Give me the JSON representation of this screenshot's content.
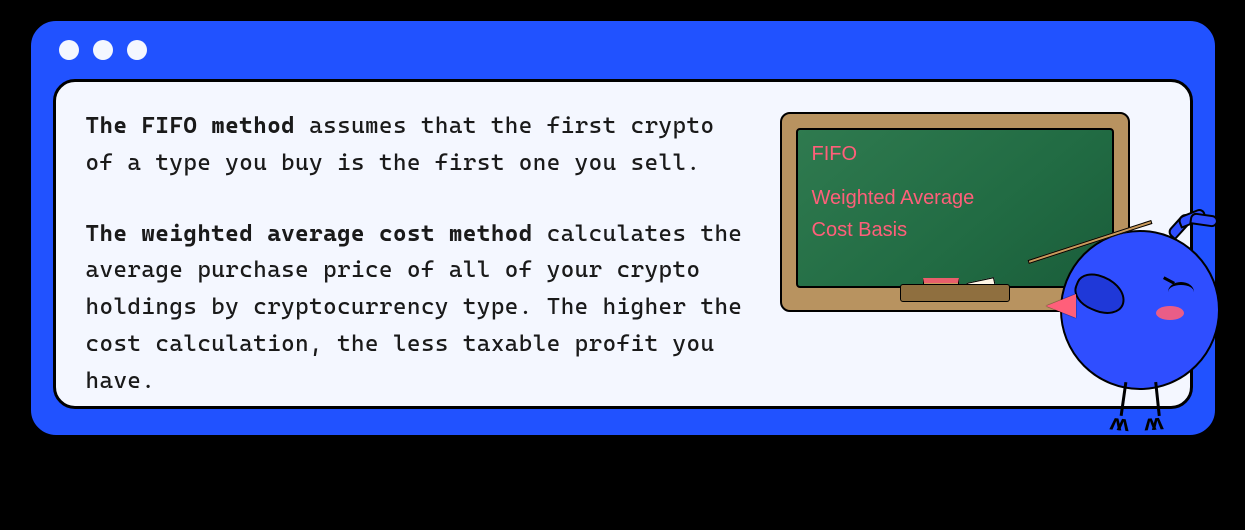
{
  "paragraphs": {
    "p1_bold": "The FIFO method",
    "p1_rest": " assumes that the first crypto of a type you buy is the first one you sell.",
    "p2_bold": "The weighted average cost method",
    "p2_rest": " calculates the average purchase price of all of your crypto holdings by cryptocurrency type. The higher the cost calculation, the less taxable profit you have."
  },
  "chalkboard": {
    "line1": "FIFO",
    "line2": "Weighted Average",
    "line3": "Cost Basis"
  },
  "colors": {
    "frame": "#2152ff",
    "panel": "#f4f7ff",
    "chalk_text": "#ff5f7a"
  }
}
